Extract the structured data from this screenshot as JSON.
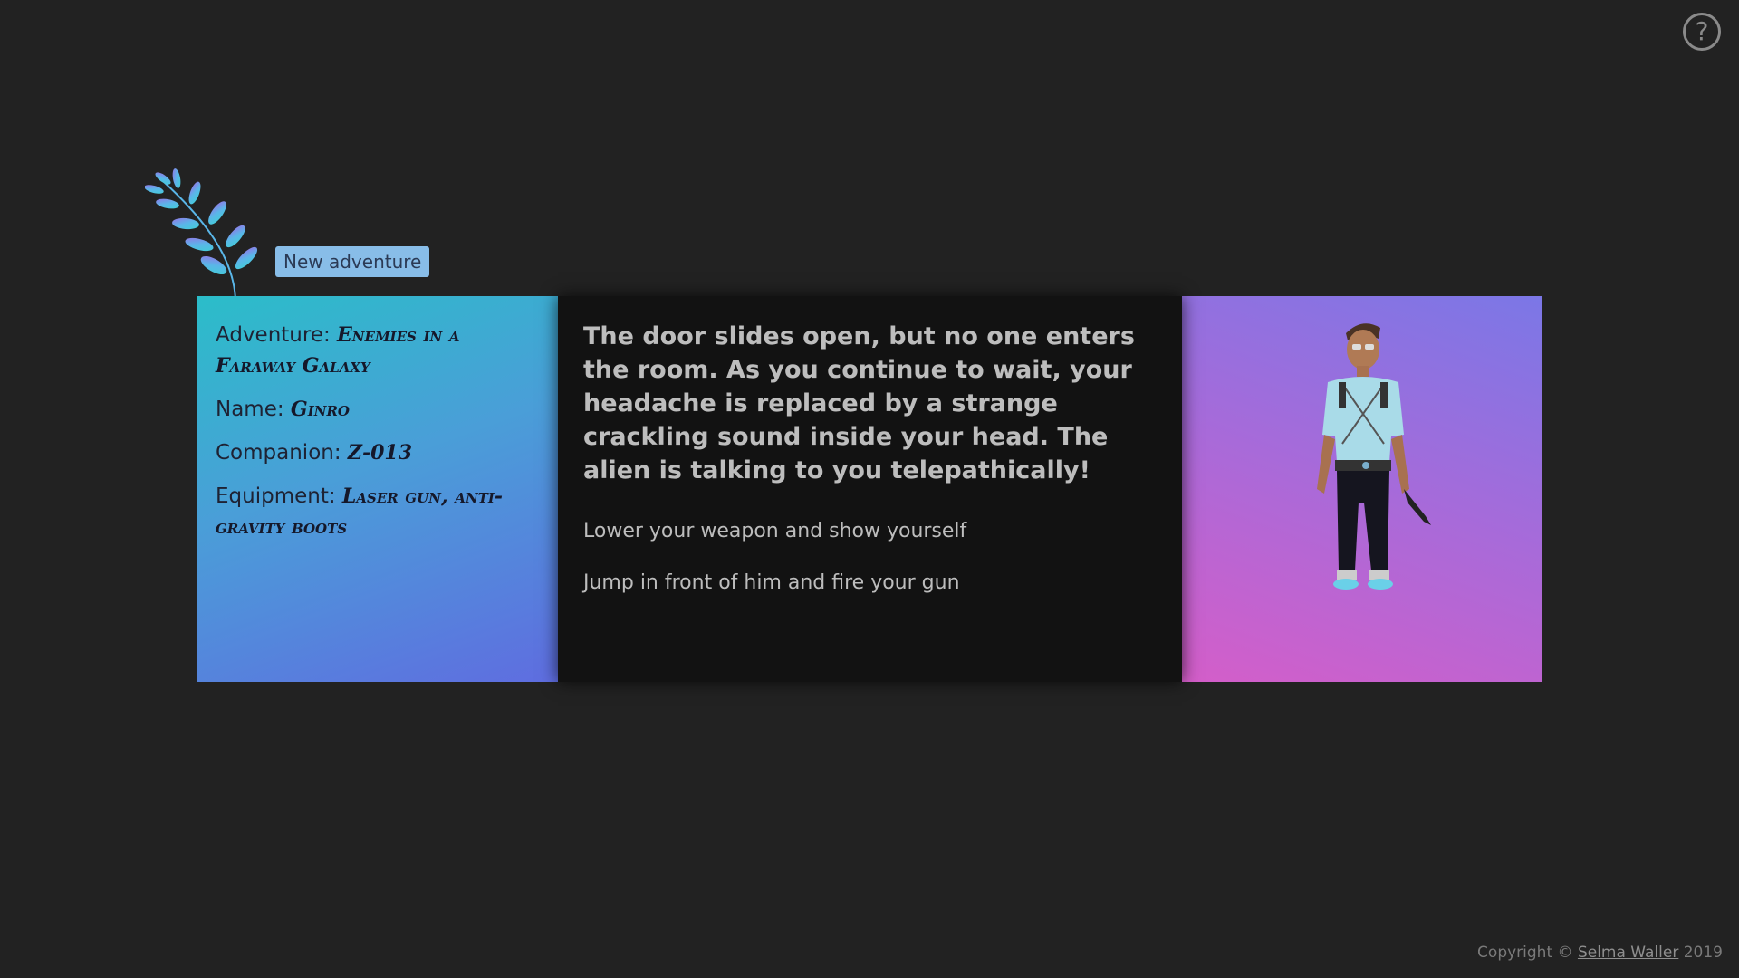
{
  "help": {
    "icon": "question-mark-icon",
    "glyph": "?"
  },
  "new_adventure_label": "New adventure",
  "character_info": {
    "adventure_label": "Adventure:",
    "adventure_value": "Enemies in a Faraway Galaxy",
    "name_label": "Name:",
    "name_value": "Ginro",
    "companion_label": "Companion:",
    "companion_value": "Z-013",
    "equipment_label": "Equipment:",
    "equipment_value": "Laser gun, anti-gravity boots"
  },
  "story": {
    "text": "The door slides open, but no one enters the room. As you continue to wait, your headache is replaced by a strange crackling sound inside your head. The alien is talking to you telepathically!",
    "choices": [
      {
        "label": "Lower your weapon and show yourself"
      },
      {
        "label": "Jump in front of him and fire your gun"
      }
    ]
  },
  "footer": {
    "prefix": "Copyright ©",
    "author": "Selma Waller",
    "year": "2019"
  },
  "colors": {
    "background": "#222222",
    "left_panel_gradient": [
      "#2bbdc9",
      "#5f6de0"
    ],
    "middle_panel": "#121212",
    "right_panel_gradient": [
      "#7b77e6",
      "#d45ec9"
    ],
    "button": "#88bde8"
  }
}
